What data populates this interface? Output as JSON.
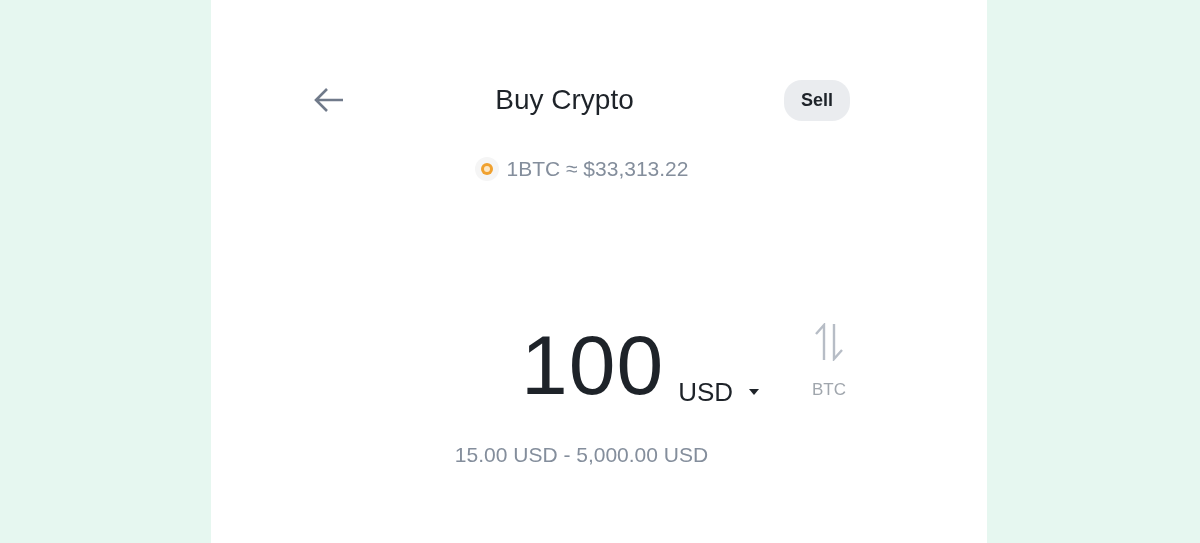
{
  "header": {
    "title": "Buy Crypto",
    "action_button": "Sell"
  },
  "rate": {
    "text": "1BTC ≈ $33,313.22"
  },
  "amount": {
    "value": "100",
    "currency": "USD"
  },
  "swap": {
    "label": "BTC"
  },
  "limits": {
    "text": "15.00 USD - 5,000.00 USD"
  }
}
